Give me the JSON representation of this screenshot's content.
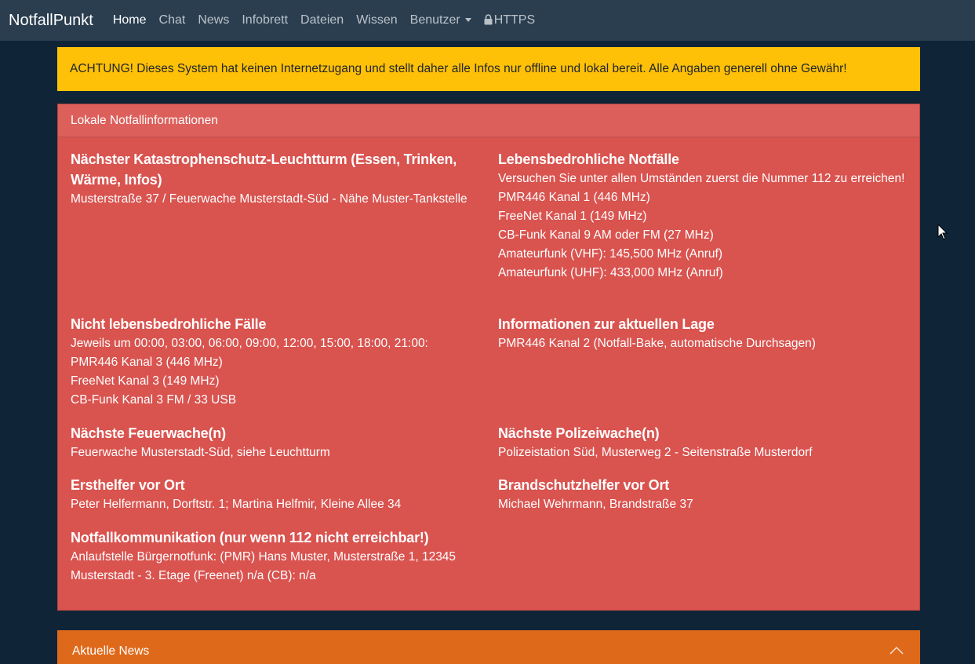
{
  "nav": {
    "brand": "NotfallPunkt",
    "items": [
      {
        "label": "Home"
      },
      {
        "label": "Chat"
      },
      {
        "label": "News"
      },
      {
        "label": "Infobrett"
      },
      {
        "label": "Dateien"
      },
      {
        "label": "Wissen"
      },
      {
        "label": "Benutzer"
      },
      {
        "label": "HTTPS"
      }
    ]
  },
  "alert": {
    "text": "ACHTUNG! Dieses System hat keinen Internetzugang und stellt daher alle Infos nur offline und lokal bereit. Alle Angaben generell ohne Gewähr!"
  },
  "card": {
    "header": "Lokale Notfallinformationen",
    "sections": [
      {
        "title": "Nächster Katastrophenschutz-Leuchtturm (Essen, Trinken, Wärme, Infos)",
        "lines": [
          "Musterstraße 37 / Feuerwache Musterstadt-Süd - Nähe Muster-Tankstelle"
        ]
      },
      {
        "title": "Lebensbedrohliche Notfälle",
        "lines": [
          "Versuchen Sie unter allen Umständen zuerst die Nummer 112 zu erreichen!",
          "PMR446 Kanal 1 (446 MHz)",
          "FreeNet Kanal 1 (149 MHz)",
          "CB-Funk Kanal 9 AM oder FM (27 MHz)",
          "Amateurfunk (VHF): 145,500 MHz (Anruf)",
          "Amateurfunk (UHF): 433,000 MHz (Anruf)"
        ]
      },
      {
        "title": "Nicht lebensbedrohliche Fälle",
        "lines": [
          "Jeweils um 00:00, 03:00, 06:00, 09:00, 12:00, 15:00, 18:00, 21:00:",
          "PMR446 Kanal 3 (446 MHz)",
          "FreeNet Kanal 3 (149 MHz)",
          "CB-Funk Kanal 3 FM / 33 USB"
        ]
      },
      {
        "title": "Informationen zur aktuellen Lage",
        "lines": [
          "PMR446 Kanal 2 (Notfall-Bake, automatische Durchsagen)"
        ]
      },
      {
        "title": "Nächste Feuerwache(n)",
        "lines": [
          "Feuerwache Musterstadt-Süd, siehe Leuchtturm"
        ]
      },
      {
        "title": "Nächste Polizeiwache(n)",
        "lines": [
          "Polizeistation Süd, Musterweg 2 - Seitenstraße Musterdorf"
        ]
      },
      {
        "title": "Ersthelfer vor Ort",
        "lines": [
          "Peter Helfermann, Dorftstr. 1; Martina Helfmir, Kleine Allee 34"
        ]
      },
      {
        "title": "Brandschutzhelfer vor Ort",
        "lines": [
          "Michael Wehrmann, Brandstraße 37"
        ]
      },
      {
        "title": "Notfallkommunikation (nur wenn 112 nicht erreichbar!)",
        "lines": [
          "Anlaufstelle Bürgernotfunk: (PMR) Hans Muster, Musterstraße 1, 12345 Musterstadt - 3. Etage (Freenet) n/a (CB): n/a"
        ]
      }
    ]
  },
  "news": {
    "title": "Aktuelle News"
  },
  "colors": {
    "navbar": "#2b3e50",
    "background": "#0f2537",
    "warning": "#ffc107",
    "danger": "#d9534f",
    "news": "#df691a"
  }
}
